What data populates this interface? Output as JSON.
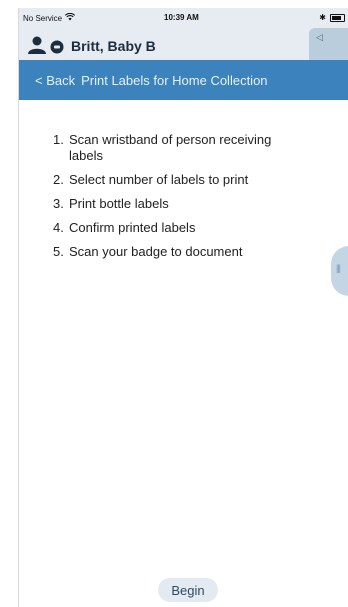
{
  "status_bar": {
    "carrier": "No Service",
    "time": "10:39 AM",
    "bluetooth": "✱"
  },
  "patient": {
    "name": "Britt, Baby B"
  },
  "tab_handle": {
    "label": "◁"
  },
  "nav": {
    "back_label": "< Back",
    "title": "Print Labels for Home Collection"
  },
  "steps": [
    {
      "num": "1.",
      "text": "Scan wristband of person receiving labels"
    },
    {
      "num": "2.",
      "text": "Select number of labels to print"
    },
    {
      "num": "3.",
      "text": "Print bottle labels"
    },
    {
      "num": "4.",
      "text": "Confirm printed labels"
    },
    {
      "num": "5.",
      "text": "Scan your badge to document"
    }
  ],
  "side_tab": {
    "label": "|||"
  },
  "begin_label": "Begin",
  "colors": {
    "nav_bar": "#3c82bd",
    "header_bg": "#e6ecf1"
  }
}
